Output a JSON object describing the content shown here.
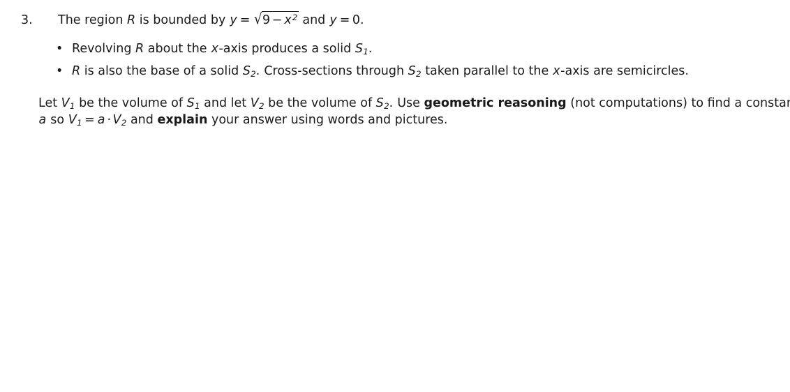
{
  "document": {
    "problem": {
      "number": "3.",
      "statement": {
        "prefix": "The region ",
        "region_var": "R",
        "middle": " is bounded by ",
        "y_var": "y",
        "equals": "=",
        "radical_sign": "√",
        "radicand_lead": "9",
        "radicand_minus": "−",
        "radicand_var": "x",
        "radicand_exponent": "2",
        "conjunction": " and ",
        "y_var2": "y",
        "equals2": "=",
        "zero": "0."
      }
    },
    "bullets": [
      {
        "marker": "•",
        "lead": "Revolving ",
        "region_var": "R",
        "mid": " about the ",
        "axis_var": "x",
        "mid2": "-axis produces a solid ",
        "solid_var": "S",
        "solid_sub": "1",
        "tail": "."
      },
      {
        "marker": "•",
        "lead": "",
        "region_var": "R",
        "mid": " is also the base of a solid ",
        "solid_var": "S",
        "solid_sub": "2",
        "mid2": ".",
        "sentence2_lead": "Cross-sections through ",
        "solid2_var": "S",
        "solid2_sub": "2",
        "mid3": " taken parallel to the ",
        "axis_var": "x",
        "tail": "-axis are semicircles."
      }
    ],
    "closing": {
      "line1": {
        "lead": "Let ",
        "v1_var": "V",
        "v1_sub": "1",
        "mid1": " be the volume of ",
        "s1_var": "S",
        "s1_sub": "1",
        "mid2": " and let ",
        "v2_var": "V",
        "v2_sub": "2",
        "mid3": " be the volume of ",
        "s2_var": "S",
        "s2_sub": "2",
        "period": ".",
        "sentence2_lead": "Use ",
        "bold_phrase": "geometric reasoning",
        "mid4": " (not computations) to find a constant"
      },
      "line2": {
        "a_var": "a",
        "lead": " so ",
        "v1_var": "V",
        "v1_sub": "1",
        "equals": "=",
        "a_var2": "a",
        "cdot": "·",
        "v2_var": "V",
        "v2_sub": "2",
        "mid": " and ",
        "bold_phrase": "explain",
        "tail": " your answer using words and pictures."
      }
    }
  },
  "colors": {
    "page_background": "#ffffff",
    "text": "#1a1a1a"
  }
}
